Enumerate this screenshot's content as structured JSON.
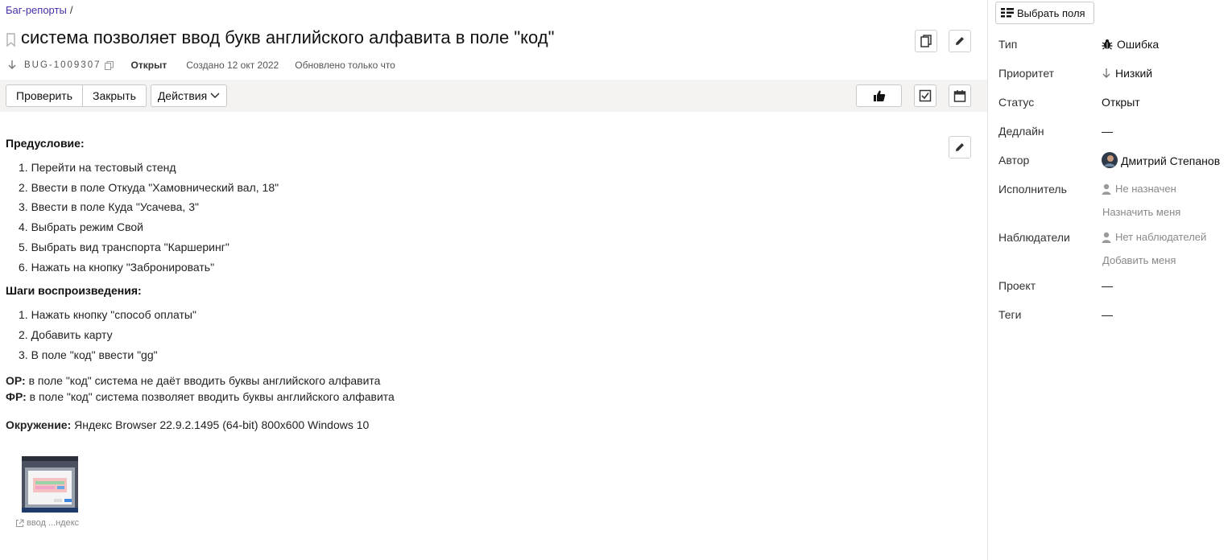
{
  "breadcrumb": {
    "link": "Баг-репорты",
    "sep": "/"
  },
  "issue": {
    "title": "система позволяет ввод букв английского алфавита в поле \"код\"",
    "key": "BUG-1009307",
    "status": "Открыт",
    "created": "Создано 12 окт 2022",
    "updated": "Обновлено только что"
  },
  "toolbar": {
    "check_label": "Проверить",
    "close_label": "Закрыть",
    "actions_label": "Действия"
  },
  "description": {
    "precondition_title": "Предусловие:",
    "precondition_items": [
      "1. Перейти на тестовый стенд",
      "2. Ввести в поле Откуда \"Хамовнический вал, 18\"",
      "3. Ввести в поле Куда \"Усачева, 3\"",
      "4. Выбрать режим Свой",
      "5. Выбрать вид транспорта \"Каршеринг\"",
      "6. Нажать на кнопку \"Забронировать\""
    ],
    "steps_title": "Шаги воспроизведения:",
    "steps_items": [
      "1. Нажать кнопку \"способ оплаты\"",
      "2. Добавить карту",
      "3. В поле \"код\" ввести \"gg\""
    ],
    "expected_label": "ОР:",
    "expected_text": " в поле \"код\" система не даёт вводить буквы английского алфавита",
    "actual_label": "ФР:",
    "actual_text": " в поле \"код\" система позволяет вводить буквы английского алфавита",
    "env_label": "Окружение:",
    "env_text": " Яндекс Browser 22.9.2.1495 (64-bit) 800x600 Windows 10",
    "attachment_caption": "ввод ...ндекс"
  },
  "sidebar": {
    "choose_fields_label": "Выбрать поля",
    "fields": {
      "type_label": "Тип",
      "type_value": "Ошибка",
      "priority_label": "Приоритет",
      "priority_value": "Низкий",
      "status_label": "Статус",
      "status_value": "Открыт",
      "deadline_label": "Дедлайн",
      "deadline_value": "—",
      "author_label": "Автор",
      "author_value": "Дмитрий Степанов",
      "assignee_label": "Исполнитель",
      "assignee_value": "Не назначен",
      "assign_me": "Назначить меня",
      "watchers_label": "Наблюдатели",
      "watchers_value": "Нет наблюдателей",
      "add_me": "Добавить меня",
      "project_label": "Проект",
      "project_value": "—",
      "tags_label": "Теги",
      "tags_value": "—"
    }
  },
  "colors": {
    "breadcrumb_link": "#4b2fa8",
    "toolbar_bg": "#f4f3f2"
  },
  "icons": [
    "bookmark-icon",
    "arrow-down-icon",
    "copy-icon",
    "clone-icon",
    "pencil-icon",
    "thumbs-up-icon",
    "checkbox-icon",
    "calendar-icon",
    "chevron-down-icon",
    "columns-icon",
    "bug-icon",
    "person-icon",
    "external-link-icon"
  ]
}
